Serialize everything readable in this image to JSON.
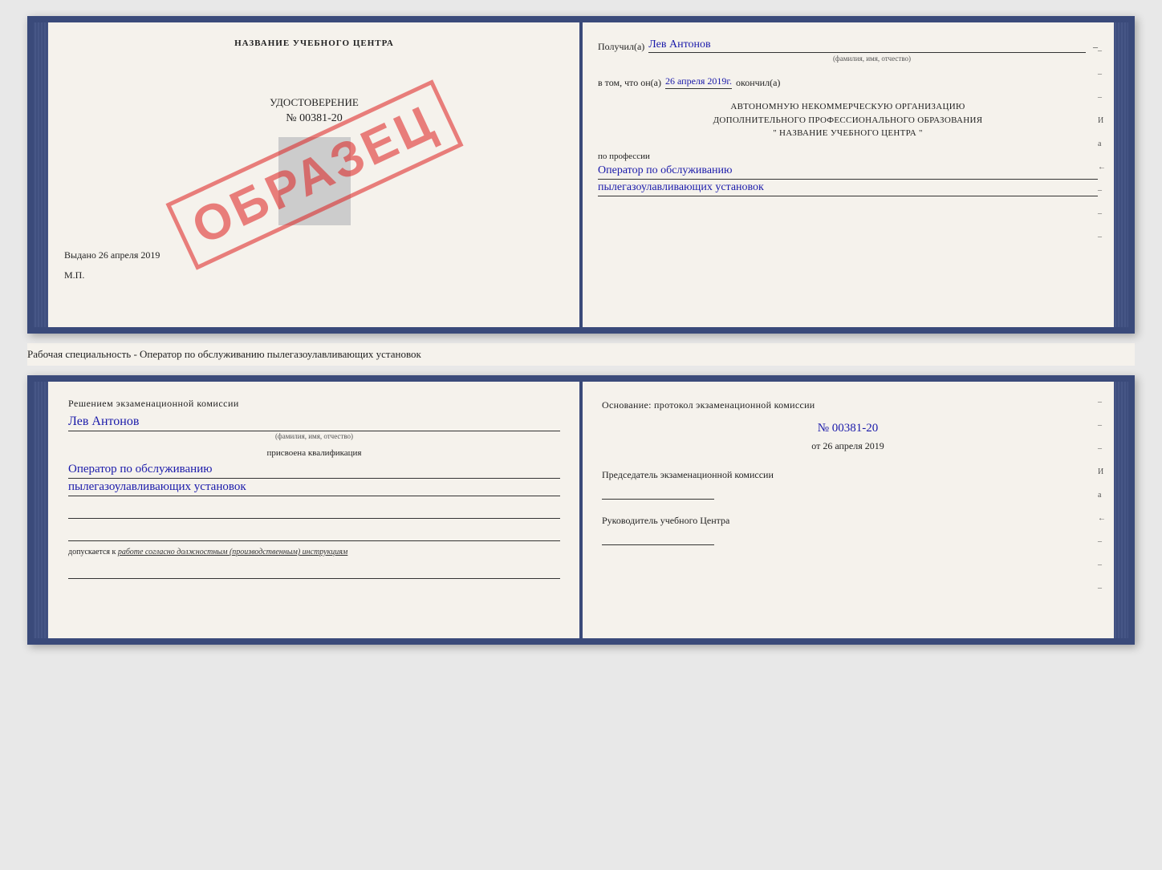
{
  "top_book": {
    "left": {
      "title": "НАЗВАНИЕ УЧЕБНОГО ЦЕНТРА",
      "stamp_text": "ОБРАЗЕЦ",
      "udostoverenie": "УДОСТОВЕРЕНИЕ",
      "number": "№ 00381-20",
      "vydano_prefix": "Выдано",
      "vydano_date": "26 апреля 2019",
      "mp": "М.П."
    },
    "right": {
      "poluchil_label": "Получил(а)",
      "poluchil_name": "Лев Антонов",
      "fio_sub": "(фамилия, имя, отчество)",
      "dash": "–",
      "vtom_label": "в том, что он(а)",
      "vtom_date": "26 апреля 2019г.",
      "okonchil": "окончил(а)",
      "org_line1": "АВТОНОМНУЮ НЕКОММЕРЧЕСКУЮ ОРГАНИЗАЦИЮ",
      "org_line2": "ДОПОЛНИТЕЛЬНОГО ПРОФЕССИОНАЛЬНОГО ОБРАЗОВАНИЯ",
      "org_line3": "\"   НАЗВАНИЕ УЧЕБНОГО ЦЕНТРА   \"",
      "po_professii": "по профессии",
      "profession1": "Оператор по обслуживанию",
      "profession2": "пылегазоулавливающих установок",
      "dashes": [
        "–",
        "–",
        "–",
        "И",
        "а",
        "←",
        "–",
        "–",
        "–"
      ]
    }
  },
  "middle_text": "Рабочая специальность - Оператор по обслуживанию пылегазоулавливающих установок",
  "bottom_book": {
    "left": {
      "resheniem": "Решением экзаменационной комиссии",
      "fio_name": "Лев Антонов",
      "fio_sub": "(фамилия, имя, отчество)",
      "prisvoena": "присвоена квалификация",
      "kvalif1": "Оператор по обслуживанию",
      "kvalif2": "пылегазоулавливающих установок",
      "dopusk_prefix": "допускается к",
      "dopusk_text": "работе согласно должностным (производственным) инструкциям"
    },
    "right": {
      "osnovanie": "Основание: протокол экзаменационной комиссии",
      "number": "№  00381-20",
      "ot_prefix": "от",
      "ot_date": "26 апреля 2019",
      "predsedatel": "Председатель экзаменационной комиссии",
      "rukovoditel": "Руководитель учебного Центра",
      "dashes": [
        "–",
        "–",
        "–",
        "И",
        "а",
        "←",
        "–",
        "–",
        "–"
      ]
    }
  }
}
